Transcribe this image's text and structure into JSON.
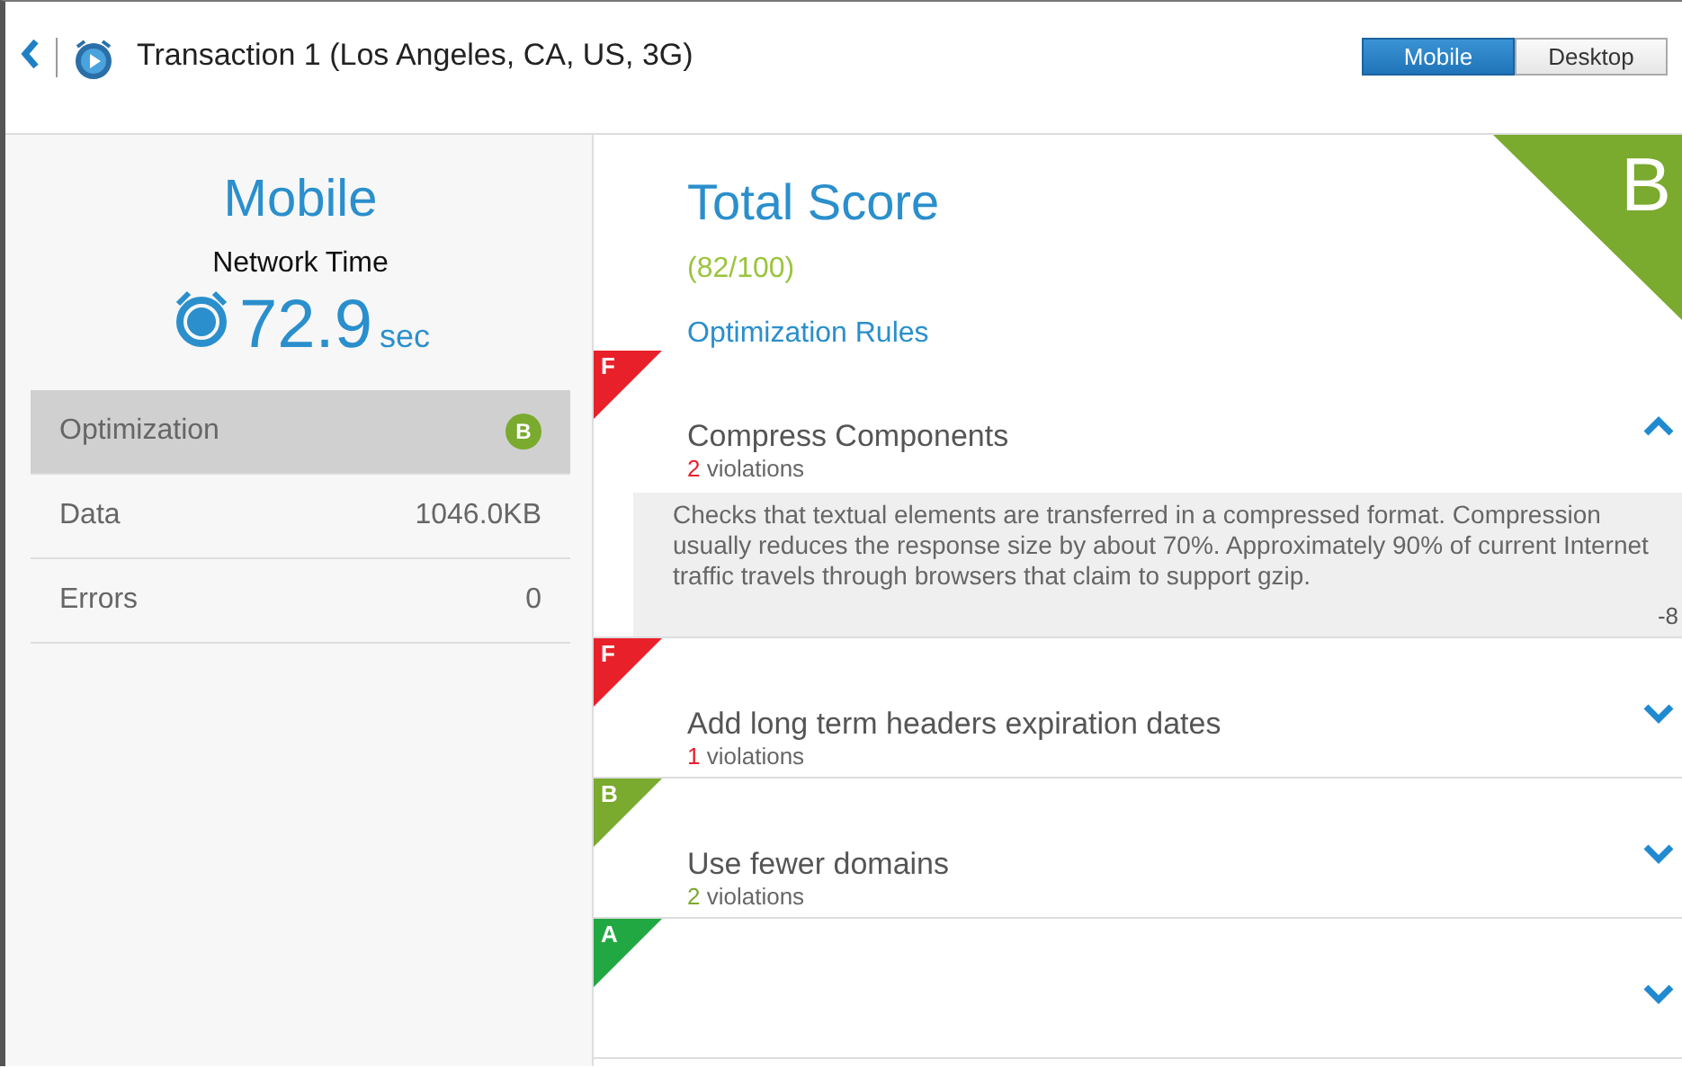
{
  "header": {
    "title": "Transaction 1 (Los Angeles, CA, US, 3G)",
    "view_toggle": [
      {
        "label": "Mobile",
        "selected": true
      },
      {
        "label": "Desktop",
        "selected": false
      }
    ]
  },
  "summary": {
    "heading": "Mobile",
    "metric_label": "Network Time",
    "metric_value": "72.9",
    "metric_unit": "sec",
    "rows": [
      {
        "label": "Optimization",
        "grade": "B",
        "color": "#7aaa2e",
        "selected": true
      },
      {
        "label": "Data",
        "value": "1046.0KB",
        "selected": false
      },
      {
        "label": "Errors",
        "value": "0",
        "selected": false
      }
    ]
  },
  "score": {
    "title": "Total Score",
    "value": "(82/100)",
    "grade": "B",
    "color": "#7aaa2e",
    "rules_heading": "Optimization Rules"
  },
  "rules": [
    {
      "grade": "F",
      "color": "#e8202a",
      "title": "Compress Components",
      "count": "2",
      "count_label": "violations",
      "expanded": true,
      "description": "Checks that textual elements are transferred in a compressed format. Compression usually reduces the response size by about 70%. Approximately 90% of current Internet traffic travels through browsers that claim to support gzip.",
      "points": "-8"
    },
    {
      "grade": "F",
      "color": "#e8202a",
      "title": "Add long term headers expiration dates",
      "count": "1",
      "count_label": "violations",
      "expanded": false
    },
    {
      "grade": "B",
      "color": "#7aaa2e",
      "title": "Use fewer domains",
      "count": "2",
      "count_label": "violations",
      "expanded": false
    },
    {
      "grade": "A",
      "color": "#22a843",
      "expanded": false
    }
  ]
}
